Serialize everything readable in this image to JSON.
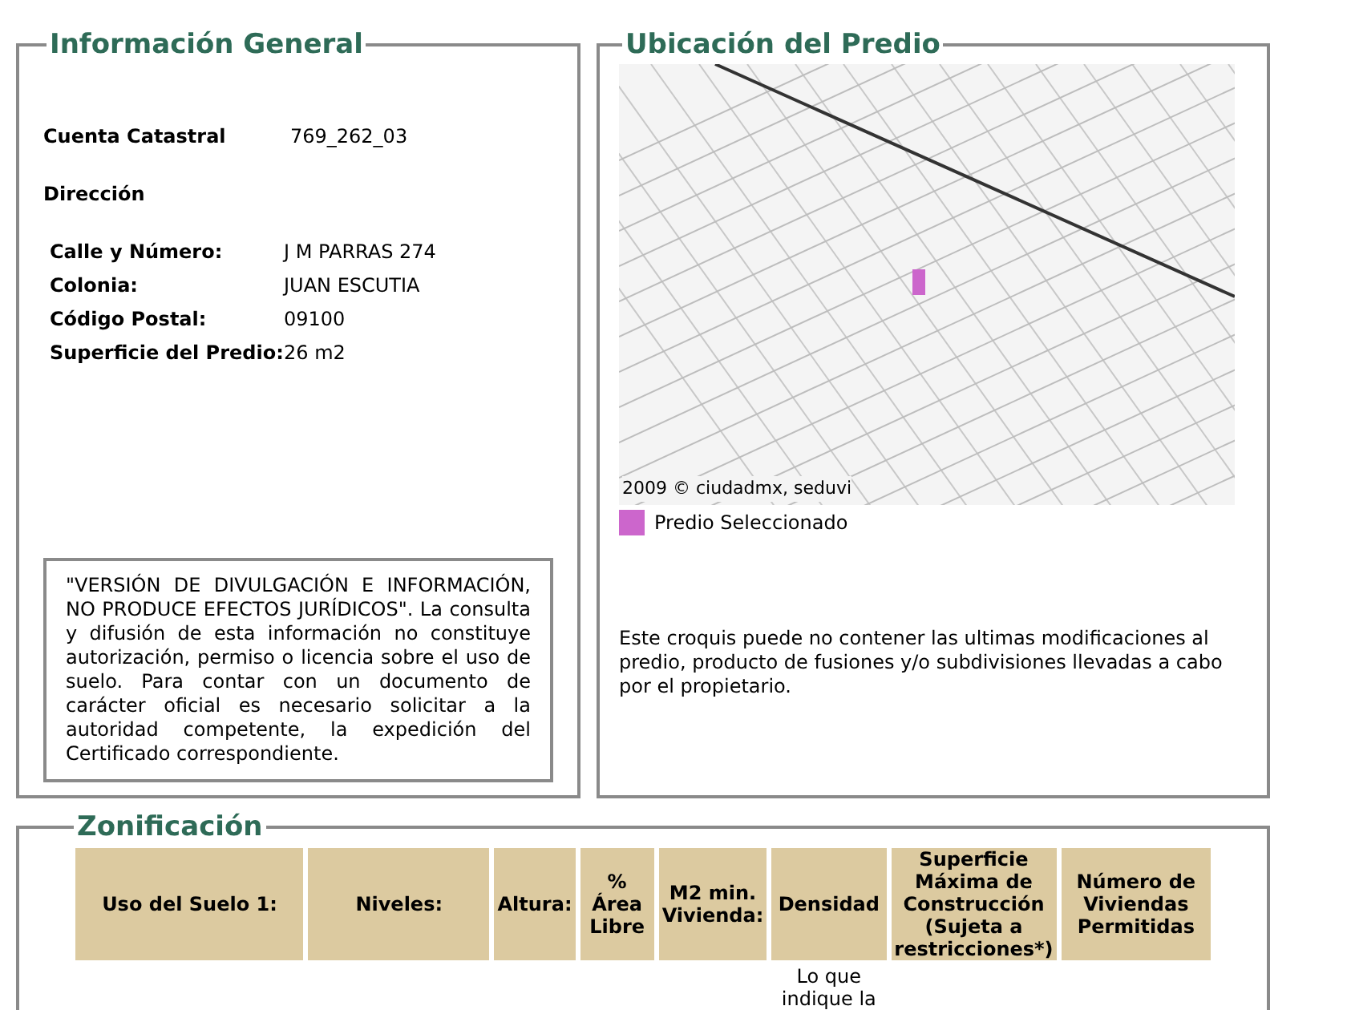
{
  "general": {
    "title": "Información General",
    "cuenta": {
      "label": "Cuenta Catastral",
      "value": "769_262_03"
    },
    "direccion_label": "Dirección",
    "fields": [
      {
        "label": "Calle y Número:",
        "value": "J M PARRAS 274"
      },
      {
        "label": "Colonia:",
        "value": "JUAN ESCUTIA"
      },
      {
        "label": "Código Postal:",
        "value": "09100"
      },
      {
        "label": "Superficie del Predio:",
        "value": "26 m2"
      }
    ],
    "disclaimer": "\"VERSIÓN DE DIVULGACIÓN E INFORMACIÓN, NO PRODUCE EFECTOS JURÍDICOS\". La consulta y difusión de esta información no constituye autorización, permiso o licencia sobre el uso de suelo. Para contar con un documento de carácter oficial es necesario solicitar a la autoridad competente, la expedición del Certificado correspondiente."
  },
  "ubicacion": {
    "title": "Ubicación del Predio",
    "map_credit": "2009 © ciudadmx, seduvi",
    "legend": {
      "label": "Predio Seleccionado",
      "color": "#cc66cc"
    },
    "note": "Este croquis puede no contener las ultimas modificaciones al predio, producto de fusiones y/o subdivisiones llevadas a cabo por el propietario."
  },
  "zonificacion": {
    "title": "Zonificación",
    "columns": [
      "Uso del Suelo 1:",
      "Niveles:",
      "Altura:",
      "% Área Libre",
      "M2 min. Vivienda:",
      "Densidad",
      "Superficie Máxima de Construcción (Sujeta a restricciones*)",
      "Número de Viviendas Permitidas"
    ],
    "rows": [
      [
        "",
        "",
        "",
        "",
        "",
        "Lo que indique la",
        "",
        ""
      ]
    ]
  }
}
